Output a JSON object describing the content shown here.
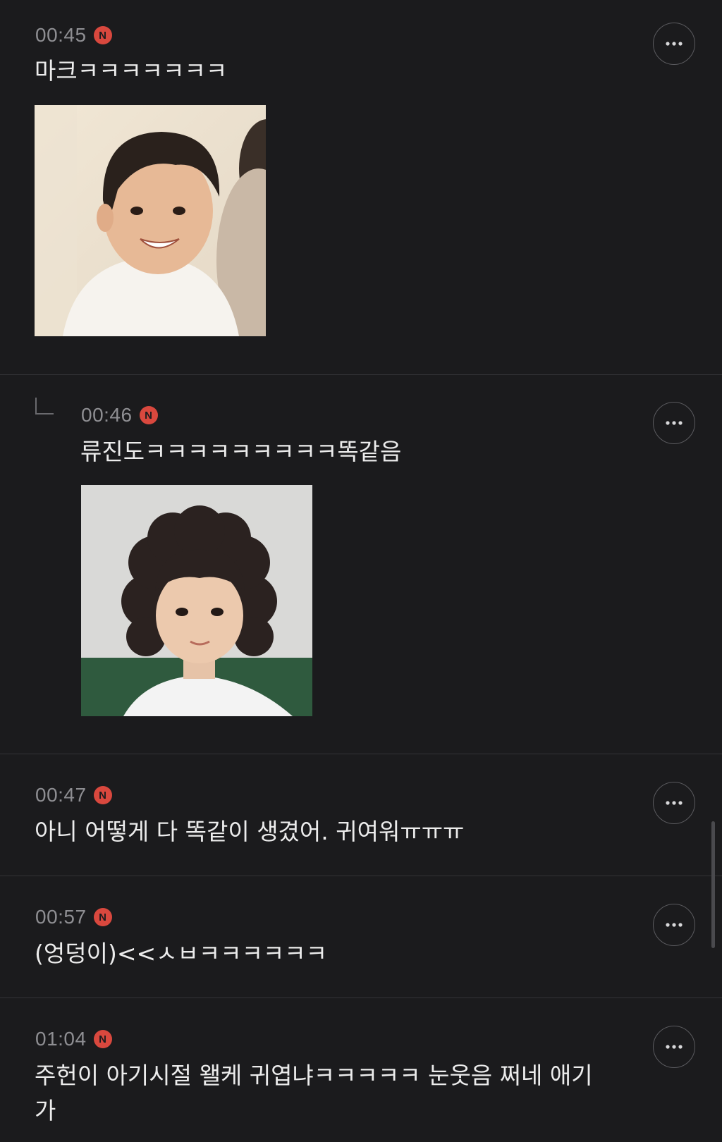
{
  "comments": [
    {
      "time": "00:45",
      "badge": "N",
      "text": "마크ㅋㅋㅋㅋㅋㅋㅋ",
      "has_image": true,
      "image_icon": "photo-toddler-boy",
      "is_reply": false
    },
    {
      "time": "00:46",
      "badge": "N",
      "text": "류진도ㅋㅋㅋㅋㅋㅋㅋㅋㅋ똑같음",
      "has_image": true,
      "image_icon": "photo-curly-hair-girl",
      "is_reply": true
    },
    {
      "time": "00:47",
      "badge": "N",
      "text": "아니 어떻게 다 똑같이 생겼어. 귀여워ㅠㅠㅠ",
      "has_image": false,
      "is_reply": false
    },
    {
      "time": "00:57",
      "badge": "N",
      "text": "(엉덩이)<<ㅅㅂㅋㅋㅋㅋㅋㅋ",
      "has_image": false,
      "is_reply": false
    },
    {
      "time": "01:04",
      "badge": "N",
      "text": "주헌이 아기시절 왤케 귀엽냐ㅋㅋㅋㅋㅋ 눈웃음 쩌네 애기\n가",
      "has_image": false,
      "is_reply": false
    }
  ],
  "icons": {
    "more": "more-horizontal-icon",
    "reply": "reply-arrow-icon",
    "new_badge": "new-badge-icon"
  },
  "colors": {
    "background": "#1b1b1d",
    "badge": "#d9483e",
    "time": "#8e8e92",
    "text": "#ececec",
    "divider": "#333336"
  }
}
